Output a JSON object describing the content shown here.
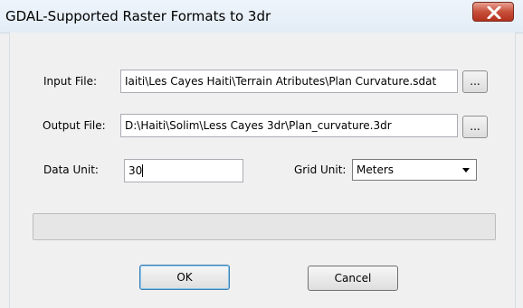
{
  "window": {
    "title": "GDAL-Supported Raster Formats to 3dr"
  },
  "form": {
    "input_file_label": "Input File:",
    "input_file_value": "Iaiti\\Les Cayes Haiti\\Terrain Atributes\\Plan Curvature.sdat",
    "output_file_label": "Output File:",
    "output_file_value": "D:\\Haiti\\Solim\\Less Cayes 3dr\\Plan_curvature.3dr",
    "browse_label": "...",
    "data_unit_label": "Data Unit:",
    "data_unit_value": "30",
    "grid_unit_label": "Grid Unit:",
    "grid_unit_value": "Meters"
  },
  "progress": {
    "value": 0
  },
  "buttons": {
    "ok": "OK",
    "cancel": "Cancel"
  },
  "icons": {
    "close": "close-icon",
    "dropdown": "chevron-down-icon"
  },
  "colors": {
    "close_button": "#c7503a",
    "window_background": "#f0f0f0"
  }
}
